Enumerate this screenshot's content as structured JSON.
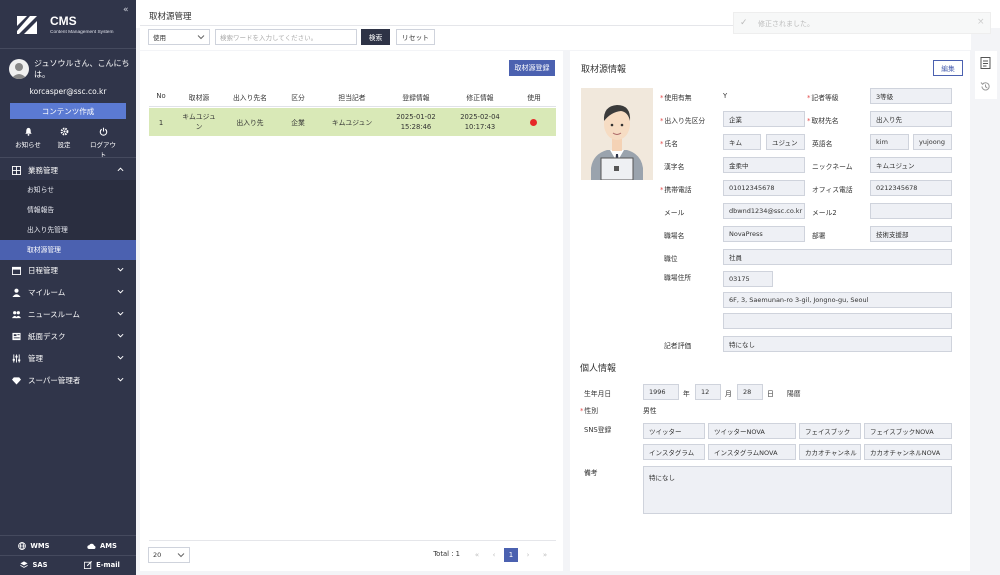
{
  "sidebar": {
    "logo_title": "CMS",
    "logo_sub": "Content Management System",
    "collapse_glyph": "«",
    "greeting": "ジュソウルさん、こんにちは。",
    "email": "korcasper@ssc.co.kr",
    "contents_button": "コンテンツ作成",
    "quick_actions": [
      {
        "label": "お知らせ",
        "icon": "bell-icon"
      },
      {
        "label": "設定",
        "icon": "gear-icon"
      },
      {
        "label": "ログアウト",
        "icon": "power-icon"
      }
    ],
    "menu": {
      "business": "業務管理",
      "sub_items": [
        "お知らせ",
        "情報報告",
        "出入り先管理",
        "取材源管理"
      ],
      "others": [
        "日程管理",
        "マイルーム",
        "ニュースルーム",
        "紙面デスク",
        "管理",
        "スーパー管理者"
      ]
    },
    "footer": [
      "WMS",
      "AMS",
      "SAS",
      "E-mail"
    ]
  },
  "header": {
    "page_title": "取材源管理"
  },
  "toast": {
    "text": "修正されました。",
    "close": "×"
  },
  "filter": {
    "use_select": "使用",
    "search_placeholder": "検索ワードを入力してください。",
    "search_button": "検索",
    "reset_button": "リセット"
  },
  "list": {
    "register_button": "取材源登録",
    "columns": [
      "No",
      "取材源",
      "出入り先名",
      "区分",
      "担当記者",
      "登録情報",
      "修正情報",
      "使用"
    ],
    "rows": [
      {
        "no": "1",
        "source_l1": "キムユジュ",
        "source_l2": "ン",
        "partner": "出入り先",
        "category": "企業",
        "reporter": "キムユジュン",
        "reg_date": "2025-01-02",
        "reg_time": "15:28:46",
        "mod_date": "2025-02-04",
        "mod_time": "10:17:43",
        "status_color": "#e62828"
      }
    ],
    "page_size": "20",
    "total": "Total : 1",
    "pages": [
      "«",
      "‹",
      "1",
      "›",
      "»"
    ]
  },
  "detail": {
    "title": "取材源情報",
    "edit_button": "編集",
    "labels": {
      "use": "使用有無",
      "grade": "記者等級",
      "partner_cat": "出入り先区分",
      "partner_name": "取材先名",
      "name": "氏名",
      "eng_name": "英語名",
      "kanji": "漢字名",
      "nickname": "ニックネーム",
      "mobile": "携帯電話",
      "office_tel": "オフィス電話",
      "mail": "メール",
      "mail2": "メール2",
      "workplace": "職場名",
      "dept": "部署",
      "position": "職位",
      "address": "職場住所",
      "evaluation": "記者評価"
    },
    "values": {
      "use": "Y",
      "grade": "3等級",
      "partner_cat": "企業",
      "partner_name": "出入り先",
      "last_name": "キム",
      "first_name": "ユジュン",
      "eng_last": "kim",
      "eng_first": "yujoong",
      "kanji": "金柔中",
      "nickname": "キムユジュン",
      "mobile": "01012345678",
      "office_tel": "0212345678",
      "mail": "dbwnd1234@ssc.co.kr",
      "mail2": "",
      "workplace": "NovaPress",
      "dept": "技術支援部",
      "position": "社員",
      "zip": "03175",
      "address1": "6F, 3, Saemunan-ro 3-gil, Jongno-gu, Seoul",
      "address2": "",
      "evaluation": "特になし"
    },
    "personal": {
      "title": "個人情報",
      "birth_label": "生年月日",
      "year": "1996",
      "year_unit": "年",
      "month": "12",
      "month_unit": "月",
      "day": "28",
      "day_unit": "日",
      "calendar": "陽暦",
      "gender_label": "性別",
      "gender": "男性",
      "sns_label": "SNS登録",
      "sns": [
        "ツイッター",
        "ツイッターNOVA",
        "フェイスブック",
        "フェイスブックNOVA",
        "インスタグラム",
        "インスタグラムNOVA",
        "カカオチャンネル",
        "カカオチャンネルNOVA"
      ],
      "note_label": "備考",
      "note": "特になし"
    }
  },
  "colors": {
    "sidebar": "#30354a",
    "accent": "#4b61b0",
    "row_highlight": "#d9e9b7",
    "required": "#e34a4a"
  }
}
